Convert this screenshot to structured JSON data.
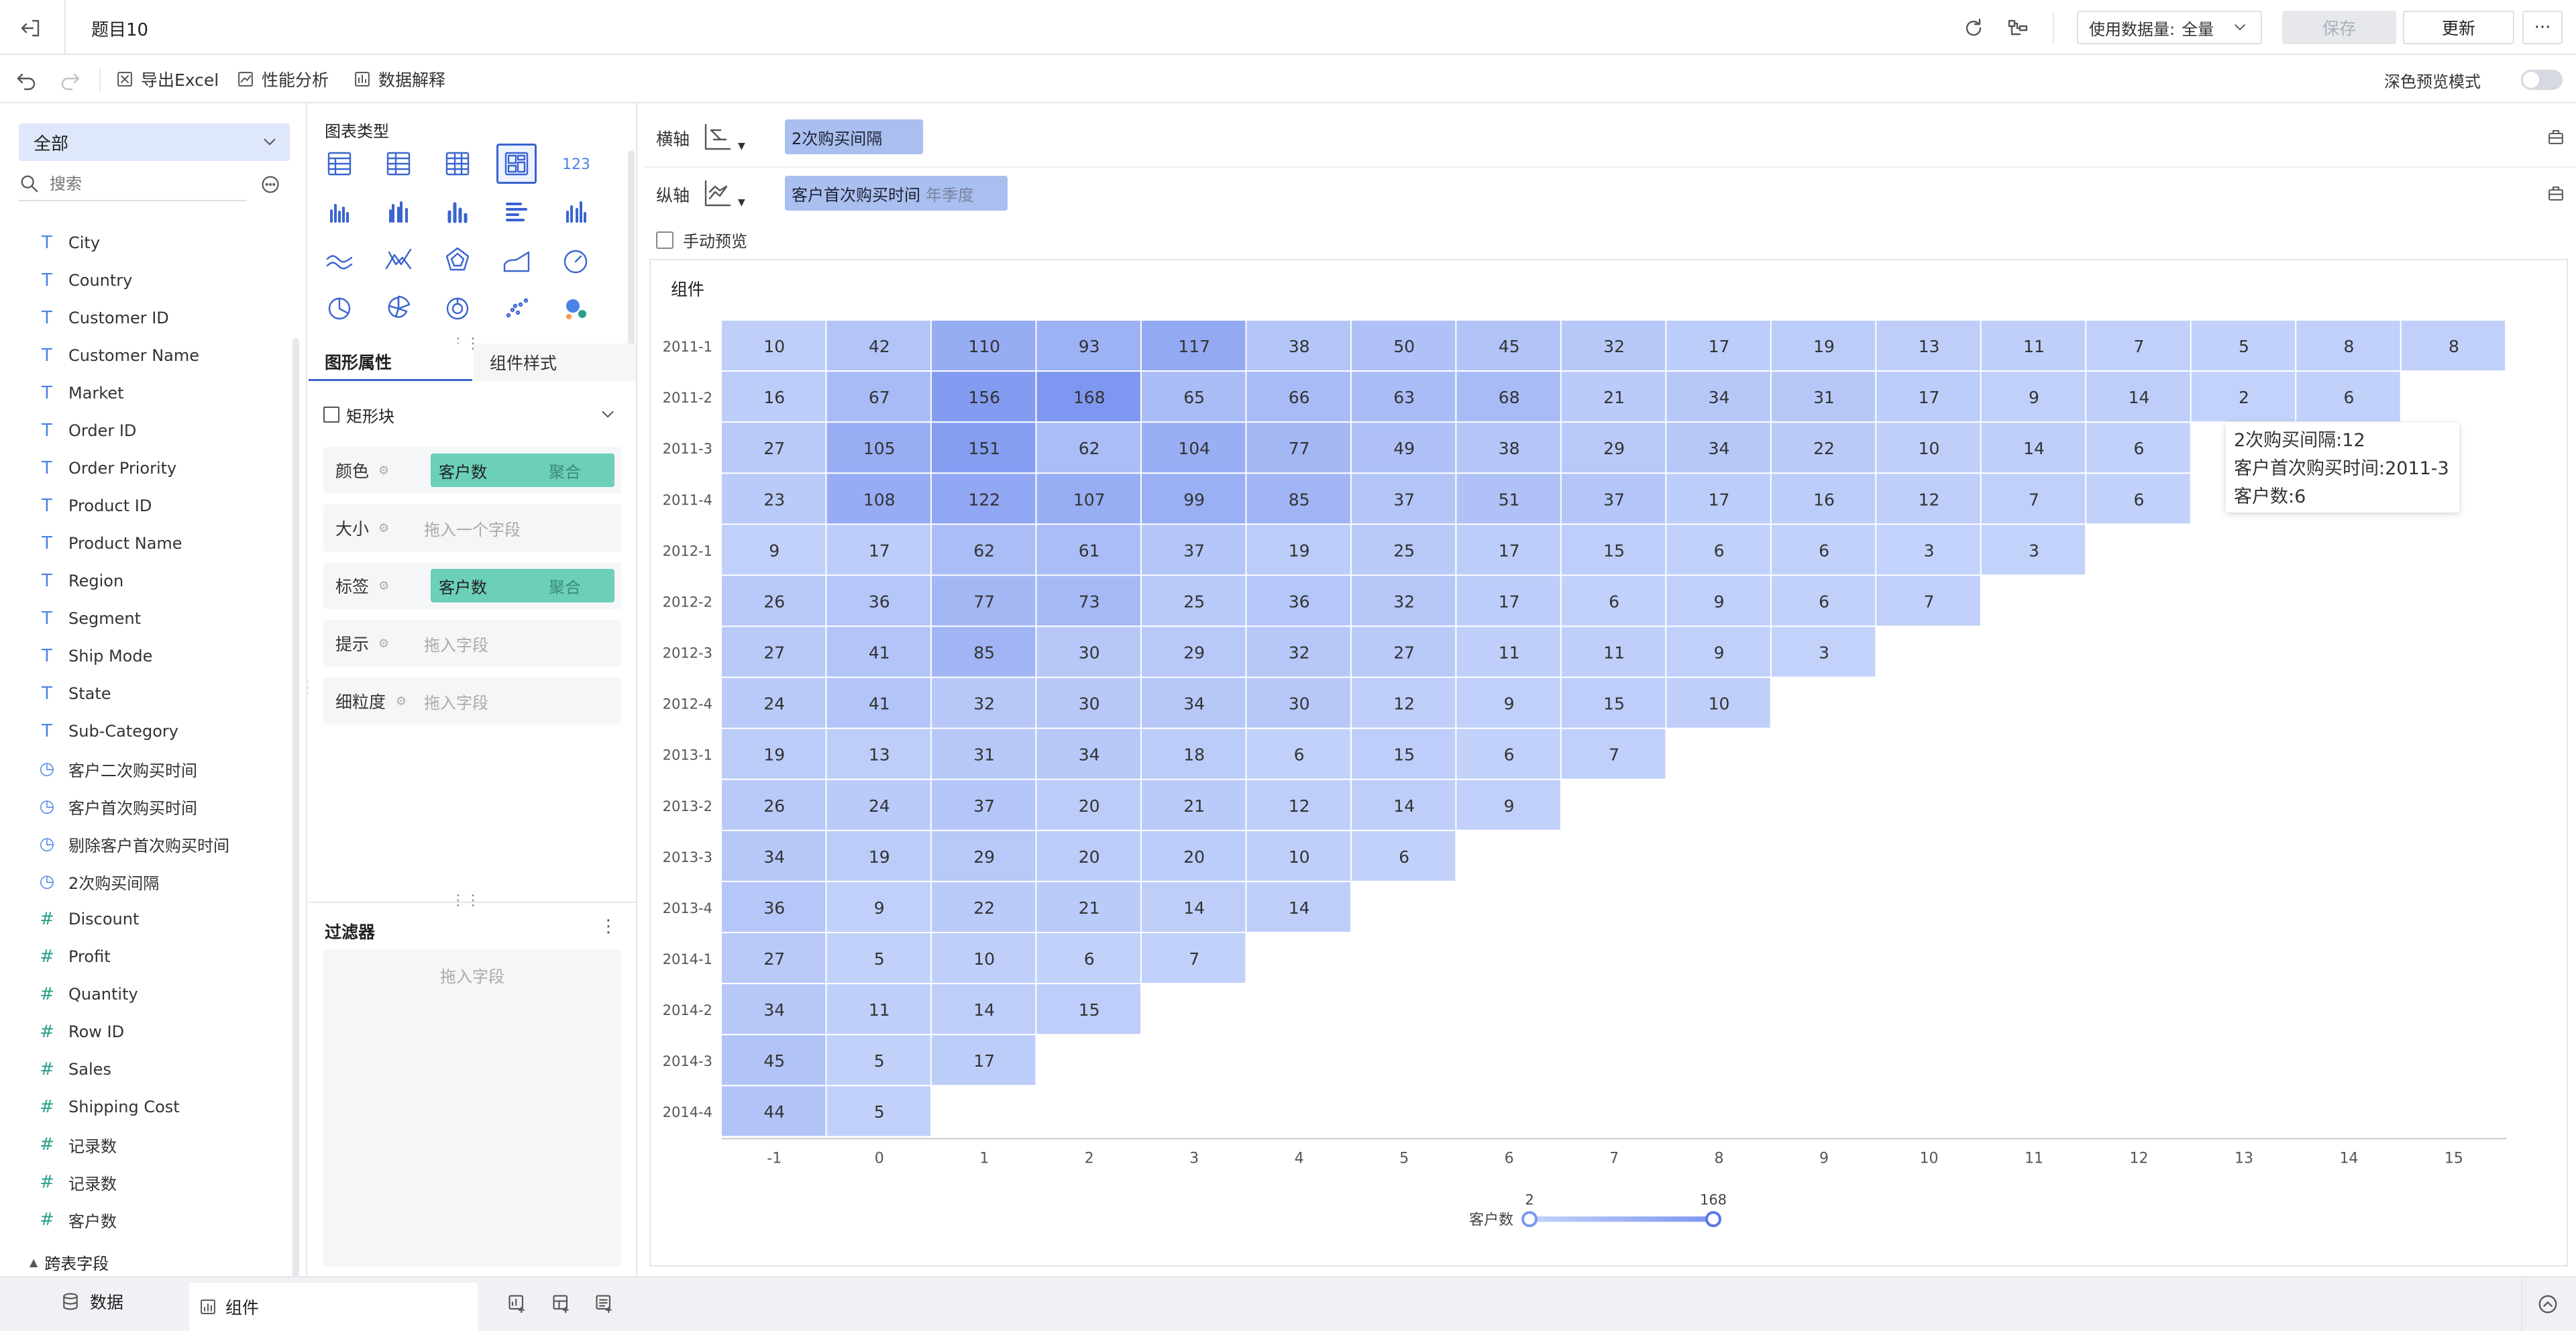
{
  "app": {
    "title": "题目10",
    "data_usage_label": "使用数据量:",
    "data_usage_value": "全量",
    "save": "保存",
    "update": "更新",
    "more": "···"
  },
  "toolbar": {
    "export_excel": "导出Excel",
    "perf_analysis": "性能分析",
    "data_explain": "数据解释",
    "dark_preview": "深色预览模式"
  },
  "fields_panel": {
    "dataset": "全部",
    "search_placeholder": "搜索",
    "fields": [
      {
        "name": "City",
        "type": "T"
      },
      {
        "name": "Country",
        "type": "T"
      },
      {
        "name": "Customer ID",
        "type": "T"
      },
      {
        "name": "Customer Name",
        "type": "T"
      },
      {
        "name": "Market",
        "type": "T"
      },
      {
        "name": "Order ID",
        "type": "T"
      },
      {
        "name": "Order Priority",
        "type": "T"
      },
      {
        "name": "Product ID",
        "type": "T"
      },
      {
        "name": "Product Name",
        "type": "T"
      },
      {
        "name": "Region",
        "type": "T"
      },
      {
        "name": "Segment",
        "type": "T"
      },
      {
        "name": "Ship Mode",
        "type": "T"
      },
      {
        "name": "State",
        "type": "T"
      },
      {
        "name": "Sub-Category",
        "type": "T"
      },
      {
        "name": "客户二次购买时间",
        "type": "date"
      },
      {
        "name": "客户首次购买时间",
        "type": "date"
      },
      {
        "name": "剔除客户首次购买时间",
        "type": "date"
      },
      {
        "name": "2次购买间隔",
        "type": "calc"
      },
      {
        "name": "Discount",
        "type": "#"
      },
      {
        "name": "Profit",
        "type": "#"
      },
      {
        "name": "Quantity",
        "type": "#"
      },
      {
        "name": "Row ID",
        "type": "#"
      },
      {
        "name": "Sales",
        "type": "#"
      },
      {
        "name": "Shipping Cost",
        "type": "#"
      },
      {
        "name": "记录数",
        "type": "#"
      },
      {
        "name": "记录数",
        "type": "#calc"
      },
      {
        "name": "客户数",
        "type": "#calc"
      }
    ],
    "cross_table": "跨表字段"
  },
  "chart_panel": {
    "chart_type_title": "图表类型",
    "tab_graphic": "图形属性",
    "tab_style": "组件样式",
    "mark_type": "矩形块",
    "props": [
      {
        "label": "颜色",
        "value": "客户数",
        "agg": "聚合"
      },
      {
        "label": "大小",
        "hint": "拖入一个字段"
      },
      {
        "label": "标签",
        "value": "客户数",
        "agg": "聚合"
      },
      {
        "label": "提示",
        "hint": "拖入字段"
      },
      {
        "label": "细粒度",
        "hint": "拖入字段"
      }
    ],
    "filter_title": "过滤器",
    "filter_hint": "拖入字段"
  },
  "shelves": {
    "x_label": "横轴",
    "x_field": "2次购买间隔",
    "y_label": "纵轴",
    "y_field": "客户首次购买时间",
    "y_suffix": "年季度",
    "manual_preview": "手动预览"
  },
  "widget_title": "组件",
  "tooltip": {
    "line1": "2次购买间隔:12",
    "line2": "客户首次购买时间:2011-3",
    "line3": "客户数:6"
  },
  "legend": {
    "title": "客户数",
    "min": "2",
    "max": "168"
  },
  "bottom_tabs": {
    "data": "数据",
    "widget": "组件"
  },
  "colors": {
    "heat_low": "#c3d2fa",
    "heat_high": "#7e97f0",
    "accent": "#3a64cf"
  },
  "chart_data": {
    "type": "heatmap",
    "x": [
      "-1",
      "0",
      "1",
      "2",
      "3",
      "4",
      "5",
      "6",
      "7",
      "8",
      "9",
      "10",
      "11",
      "12",
      "13",
      "14",
      "15"
    ],
    "y": [
      "2011-1",
      "2011-2",
      "2011-3",
      "2011-4",
      "2012-1",
      "2012-2",
      "2012-3",
      "2012-4",
      "2013-1",
      "2013-2",
      "2013-3",
      "2013-4",
      "2014-1",
      "2014-2",
      "2014-3",
      "2014-4"
    ],
    "values": [
      [
        10,
        42,
        110,
        93,
        117,
        38,
        50,
        45,
        32,
        17,
        19,
        13,
        11,
        7,
        5,
        8,
        8
      ],
      [
        16,
        67,
        156,
        168,
        65,
        66,
        63,
        68,
        21,
        34,
        31,
        17,
        9,
        14,
        2,
        6
      ],
      [
        27,
        105,
        151,
        62,
        104,
        77,
        49,
        38,
        29,
        34,
        22,
        10,
        14,
        6
      ],
      [
        23,
        108,
        122,
        107,
        99,
        85,
        37,
        51,
        37,
        17,
        16,
        12,
        7,
        6
      ],
      [
        9,
        17,
        62,
        61,
        37,
        19,
        25,
        17,
        15,
        6,
        6,
        3,
        3
      ],
      [
        26,
        36,
        77,
        73,
        25,
        36,
        32,
        17,
        6,
        9,
        6,
        7
      ],
      [
        27,
        41,
        85,
        30,
        29,
        32,
        27,
        11,
        11,
        9,
        3
      ],
      [
        24,
        41,
        32,
        30,
        34,
        30,
        12,
        9,
        15,
        10
      ],
      [
        19,
        13,
        31,
        34,
        18,
        6,
        15,
        6,
        7
      ],
      [
        26,
        24,
        37,
        20,
        21,
        12,
        14,
        9
      ],
      [
        34,
        19,
        29,
        20,
        20,
        10,
        6
      ],
      [
        36,
        9,
        22,
        21,
        14,
        14
      ],
      [
        27,
        5,
        10,
        6,
        7
      ],
      [
        34,
        11,
        14,
        15
      ],
      [
        45,
        5,
        17
      ],
      [
        44,
        5
      ]
    ],
    "color_range": [
      2,
      168
    ]
  }
}
